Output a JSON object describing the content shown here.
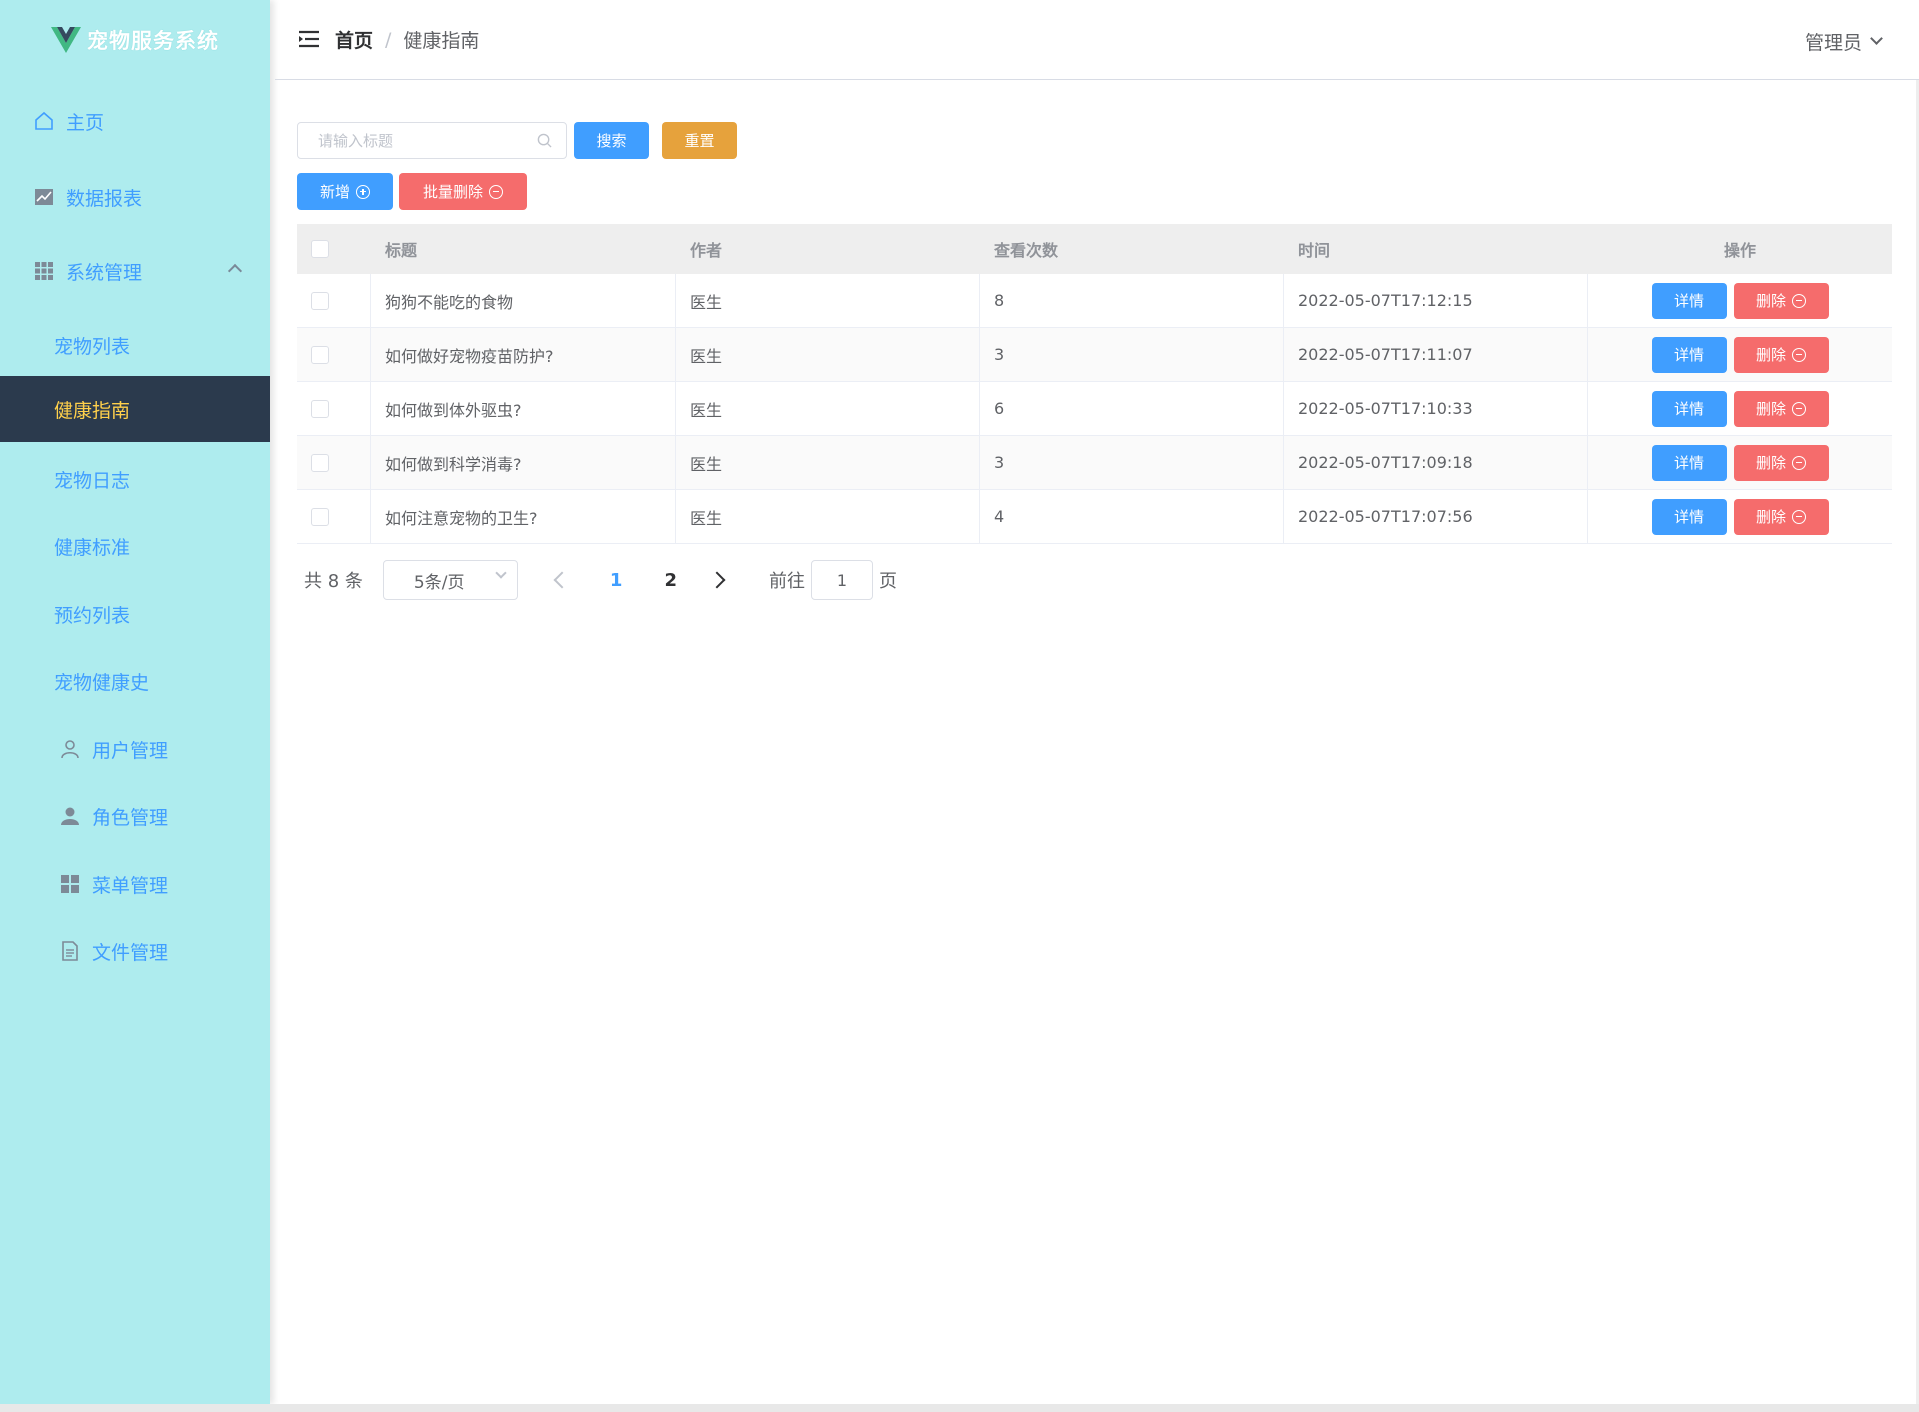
{
  "app": {
    "title": "宠物服务系统"
  },
  "sidebar": {
    "items": [
      {
        "label": "主页",
        "icon": "home-icon"
      },
      {
        "label": "数据报表",
        "icon": "chart-icon"
      },
      {
        "label": "系统管理",
        "icon": "grid-icon",
        "expanded": true
      },
      {
        "label": "宠物列表"
      },
      {
        "label": "健康指南",
        "active": true
      },
      {
        "label": "宠物日志"
      },
      {
        "label": "健康标准"
      },
      {
        "label": "预约列表"
      },
      {
        "label": "宠物健康史"
      },
      {
        "label": "用户管理",
        "icon": "user-outline-icon"
      },
      {
        "label": "角色管理",
        "icon": "user-solid-icon"
      },
      {
        "label": "菜单管理",
        "icon": "menu-grid-icon"
      },
      {
        "label": "文件管理",
        "icon": "document-icon"
      }
    ]
  },
  "header": {
    "breadcrumb": {
      "home": "首页",
      "separator": "/",
      "current": "健康指南"
    },
    "user": "管理员"
  },
  "toolbar": {
    "search_placeholder": "请输入标题",
    "search_label": "搜索",
    "reset_label": "重置",
    "add_label": "新增",
    "batch_delete_label": "批量删除"
  },
  "table": {
    "columns": [
      "标题",
      "作者",
      "查看次数",
      "时间",
      "操作"
    ],
    "detail_label": "详情",
    "delete_label": "删除",
    "rows": [
      {
        "title": "狗狗不能吃的食物",
        "author": "医生",
        "views": "8",
        "time": "2022-05-07T17:12:15"
      },
      {
        "title": "如何做好宠物疫苗防护?",
        "author": "医生",
        "views": "3",
        "time": "2022-05-07T17:11:07"
      },
      {
        "title": "如何做到体外驱虫?",
        "author": "医生",
        "views": "6",
        "time": "2022-05-07T17:10:33"
      },
      {
        "title": "如何做到科学消毒?",
        "author": "医生",
        "views": "3",
        "time": "2022-05-07T17:09:18"
      },
      {
        "title": "如何注意宠物的卫生?",
        "author": "医生",
        "views": "4",
        "time": "2022-05-07T17:07:56"
      }
    ]
  },
  "pagination": {
    "total": "共 8 条",
    "page_size": "5条/页",
    "pages": [
      "1",
      "2"
    ],
    "current_page": "1",
    "goto_prefix": "前往",
    "goto_value": "1",
    "goto_suffix": "页"
  },
  "colors": {
    "sidebar_bg": "#aeecee",
    "active_bg": "#2b3a4d",
    "active_text": "#ffd04b",
    "primary": "#409eff",
    "warning": "#e6a23c",
    "danger": "#f56c6c"
  }
}
